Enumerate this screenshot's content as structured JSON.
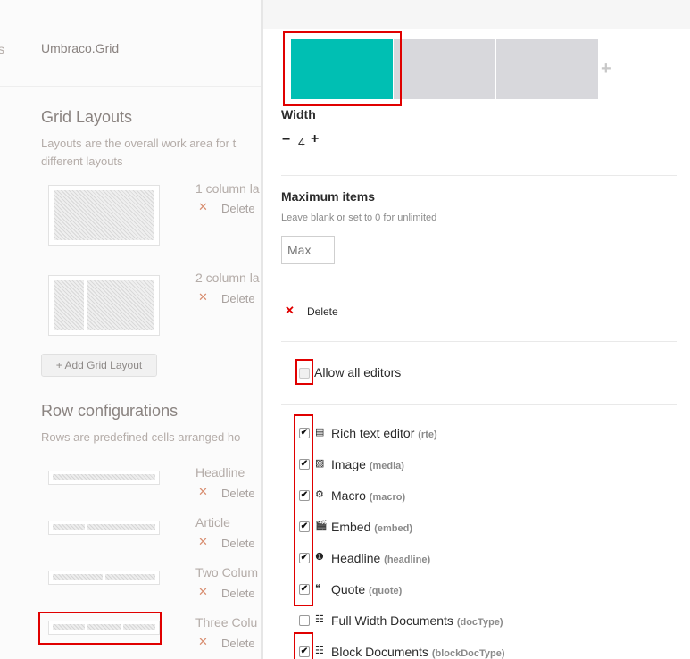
{
  "background_page": {
    "row_prefix": "s",
    "editor_name": "Umbraco.Grid",
    "grid_layouts": {
      "title": "Grid Layouts",
      "description_line1": "Layouts are the overall work area for t",
      "description_line2": "different layouts",
      "items": [
        {
          "label": "1 column la",
          "delete_label": "Delete"
        },
        {
          "label": "2 column la",
          "delete_label": "Delete"
        }
      ],
      "add_label": "Add Grid Layout"
    },
    "row_configurations": {
      "title": "Row configurations",
      "description": "Rows are predefined cells arranged ho",
      "items": [
        {
          "label": "Headline",
          "delete_label": "Delete"
        },
        {
          "label": "Article",
          "delete_label": "Delete"
        },
        {
          "label": "Two Colum",
          "delete_label": "Delete"
        },
        {
          "label": "Three Colu",
          "delete_label": "Delete"
        }
      ]
    }
  },
  "panel": {
    "cells_preview": {
      "selected_color": "#00bfb3",
      "empty_color": "#d8d8dc",
      "add_glyph": "+"
    },
    "width": {
      "label": "Width",
      "minus": "−",
      "value": "4",
      "plus": "+"
    },
    "max_items": {
      "label": "Maximum items",
      "hint": "Leave blank or set to 0 for unlimited",
      "placeholder": "Max"
    },
    "delete_label": "Delete",
    "allow_all_editors": {
      "label": "Allow all editors",
      "checked": false
    },
    "editors": [
      {
        "name": "Rich text editor",
        "alias": "(rte)",
        "icon": "rich-text-icon",
        "glyph": "▤",
        "checked": true
      },
      {
        "name": "Image",
        "alias": "(media)",
        "icon": "image-icon",
        "glyph": "▨",
        "checked": true
      },
      {
        "name": "Macro",
        "alias": "(macro)",
        "icon": "cogs-icon",
        "glyph": "⚙",
        "checked": true
      },
      {
        "name": "Embed",
        "alias": "(embed)",
        "icon": "film-icon",
        "glyph": "🎬",
        "checked": true
      },
      {
        "name": "Headline",
        "alias": "(headline)",
        "icon": "headline-icon",
        "glyph": "❶",
        "checked": true
      },
      {
        "name": "Quote",
        "alias": "(quote)",
        "icon": "quote-icon",
        "glyph": "❝",
        "checked": true
      },
      {
        "name": "Full Width Documents",
        "alias": "(docType)",
        "icon": "grid-icon",
        "glyph": "☷",
        "checked": false
      },
      {
        "name": "Block Documents",
        "alias": "(blockDocType)",
        "icon": "grid-icon",
        "glyph": "☷",
        "checked": true
      }
    ],
    "checkmark": "✔",
    "accent_delete_color": "#e00000"
  }
}
